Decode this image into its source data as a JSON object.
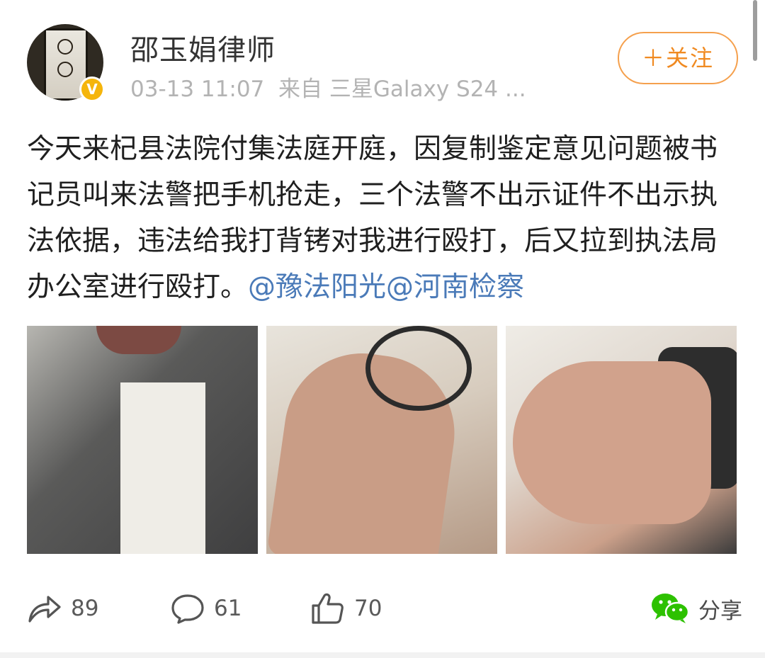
{
  "user": {
    "name": "邵玉娟律师",
    "verified_badge": "V"
  },
  "post": {
    "time": "03-13 11:07",
    "source": "来自 三星Galaxy S24 ...",
    "text": "今天来杞县法院付集法庭开庭，因复制鉴定意见问题被书记员叫来法警把手机抢走，三个法警不出示证件不出示执法依据，违法给我打背铐对我进行殴打，后又拉到执法局办公室进行殴打。",
    "mentions": [
      "@豫法阳光",
      "@河南检察"
    ],
    "photos": [
      "photo-face-suit",
      "photo-arm-bracelet",
      "photo-hand-wrist"
    ]
  },
  "follow_button": {
    "label": "＋关注"
  },
  "actions": {
    "repost": {
      "icon": "repost-icon",
      "count": "89"
    },
    "comment": {
      "icon": "comment-icon",
      "count": "61"
    },
    "like": {
      "icon": "thumbs-up-icon",
      "count": "70"
    },
    "share": {
      "icon": "wechat-icon",
      "label": "分享"
    }
  },
  "colors": {
    "link": "#4a7ab8",
    "follow": "#f08a21",
    "verified": "#f5b50b",
    "share_green": "#2dc100"
  }
}
